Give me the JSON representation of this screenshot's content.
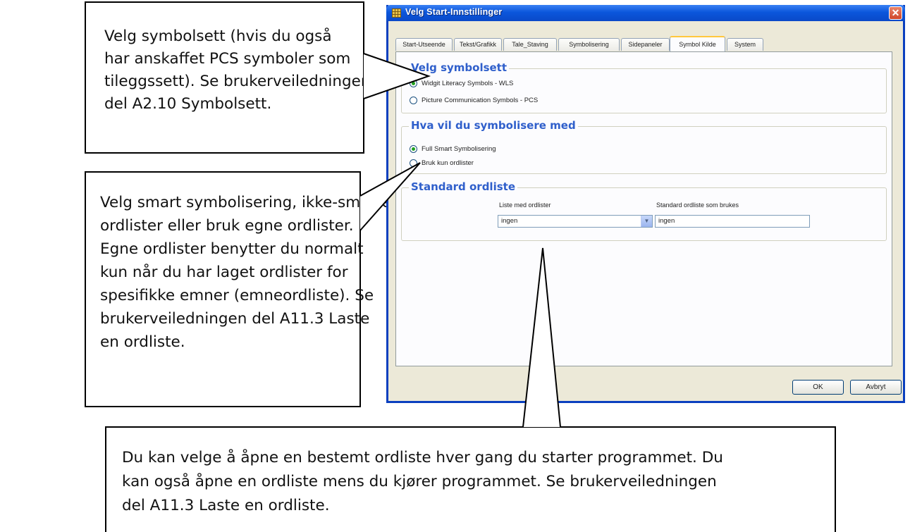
{
  "callouts": {
    "symbolset": {
      "lines": [
        "Velg symbolsett (hvis du også",
        "har anskaffet PCS symboler som",
        "tileggssett). Se brukerveiledningen",
        "del A2.10 Symbolsett."
      ]
    },
    "smart": {
      "lines": [
        "Velg smart symbolisering, ikke-smarte",
        "ordlister eller bruk egne ordlister.",
        "Egne ordlister benytter du normalt",
        "kun når du har laget ordlister for",
        "spesifikke emner (emneordliste). Se",
        "brukerveiledningen del A11.3 Laste",
        "en ordliste."
      ]
    },
    "wordlist": {
      "lines": [
        "Du kan velge å åpne en bestemt ordliste hver gang du starter programmet. Du",
        "kan også åpne en ordliste mens du kjører programmet. Se brukerveiledningen",
        "del A11.3 Laste en ordliste."
      ]
    }
  },
  "dialog": {
    "title": "Velg Start-Innstillinger",
    "close_label": "✕",
    "tabs": [
      {
        "label": "Start-Utseende"
      },
      {
        "label": "Tekst/Grafikk"
      },
      {
        "label": "Tale_Staving"
      },
      {
        "label": "Symbolisering"
      },
      {
        "label": "Sidepaneler"
      },
      {
        "label": "Symbol Kilde",
        "active": true
      },
      {
        "label": "System"
      }
    ],
    "group_symbolset": {
      "title": "Velg symbolsett",
      "options": [
        {
          "label": "Widgit Literacy Symbols - WLS",
          "checked": true
        },
        {
          "label": "Picture Communication Symbols - PCS",
          "checked": false
        }
      ]
    },
    "group_symbolise": {
      "title": "Hva vil du symbolisere med",
      "options": [
        {
          "label": "Full Smart Symbolisering",
          "checked": true
        },
        {
          "label": "Bruk kun ordlister",
          "checked": false
        }
      ]
    },
    "group_wordlist": {
      "title": "Standard ordliste",
      "list_label": "Liste med ordlister",
      "list_value": "ingen",
      "default_label": "Standard ordliste som brukes",
      "default_value": "ingen"
    },
    "ok_label": "OK",
    "cancel_label": "Avbryt"
  }
}
